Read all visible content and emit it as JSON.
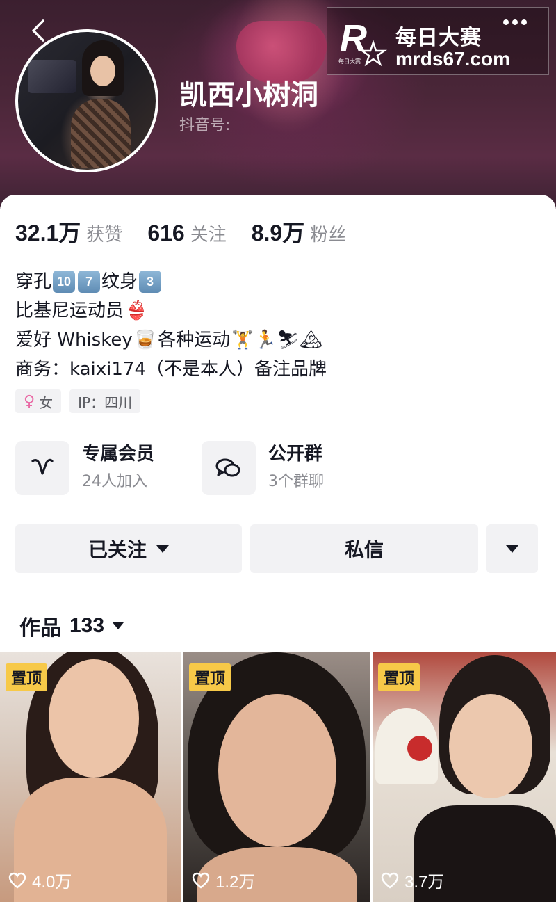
{
  "header": {
    "nickname": "凯西小树洞",
    "douyin_id_label": "抖音号:"
  },
  "watermark": {
    "logo_letter": "R",
    "logo_sub": "每日大赛",
    "title": "每日大赛",
    "url": "mrds67.com"
  },
  "stats": [
    {
      "value": "32.1万",
      "label": "获赞"
    },
    {
      "value": "616",
      "label": "关注"
    },
    {
      "value": "8.9万",
      "label": "粉丝"
    }
  ],
  "bio": {
    "line1_text": "穿孔",
    "line1_box1": "10",
    "line1_box2": "7",
    "line1_text2": "纹身",
    "line1_box3": "3",
    "line2_text": "比基尼运动员",
    "line2_emoji": "👙",
    "line3_text1": "爱好 Whiskey",
    "line3_emoji1": "🥃",
    "line3_text2": "各种运动",
    "line3_emoji2": "🏋🏃⛷🏔",
    "line4_text": "商务：kaixi174（不是本人）备注品牌"
  },
  "tags": {
    "gender_icon": "female-icon",
    "gender_symbol": "♀",
    "gender": "女",
    "ip": "IP：四川"
  },
  "features": [
    {
      "title": "专属会员",
      "sub": "24人加入",
      "icon": "v-icon"
    },
    {
      "title": "公开群",
      "sub": "3个群聊",
      "icon": "chat-bubbles-icon"
    }
  ],
  "actions": {
    "follow_label": "已关注",
    "message_label": "私信"
  },
  "works": {
    "label": "作品",
    "count": "133"
  },
  "tiles": [
    {
      "pinned": "置顶",
      "likes": "4.0万"
    },
    {
      "pinned": "置顶",
      "likes": "1.2万"
    },
    {
      "pinned": "置顶",
      "likes": "3.7万"
    }
  ],
  "colors": {
    "accent_pin": "#f7c948",
    "banner": "#4a2638",
    "button_bg": "#f2f2f4",
    "muted_text": "#8a8b91"
  }
}
